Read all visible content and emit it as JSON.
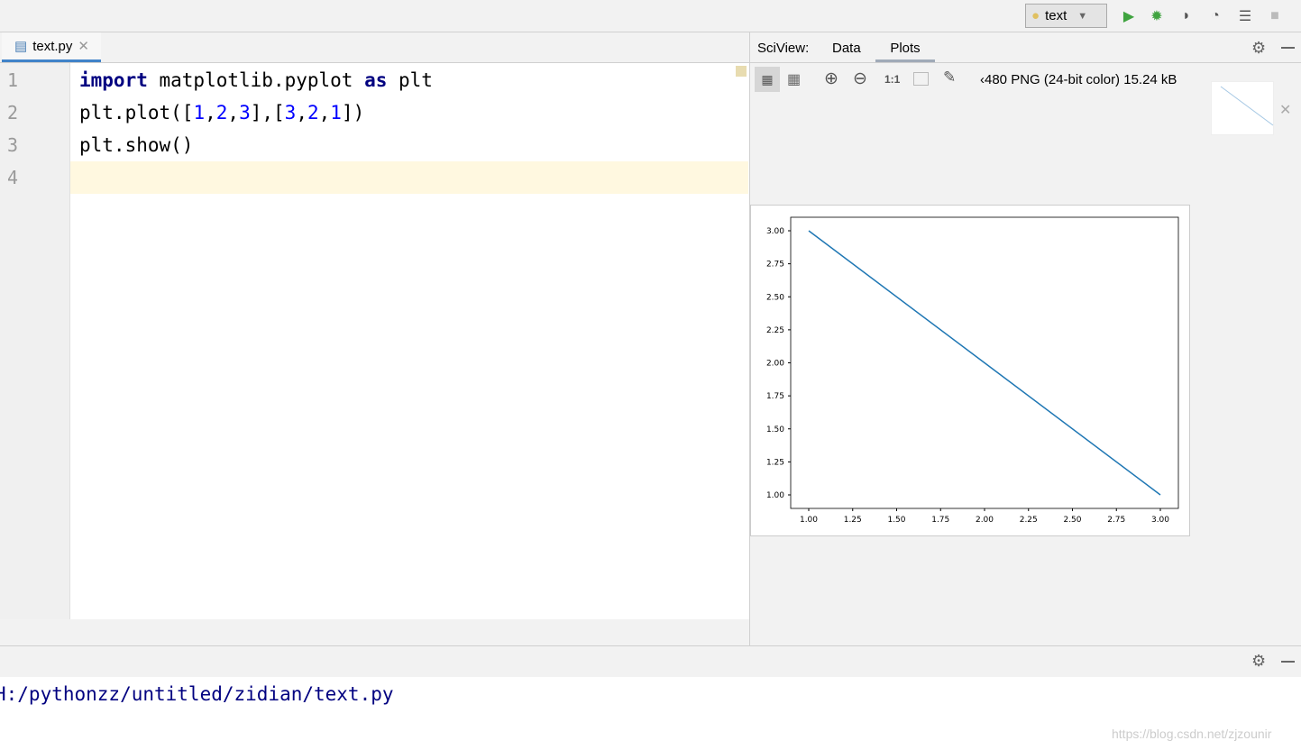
{
  "toolbar": {
    "run_config": "text",
    "icons": [
      "python-icon",
      "run-icon",
      "debug-icon",
      "coverage-icon",
      "profile-icon",
      "run-concurrency-icon",
      "stop-icon"
    ]
  },
  "editor": {
    "tab": "text.py",
    "lines": [
      {
        "n": "1"
      },
      {
        "n": "2"
      },
      {
        "n": "3"
      },
      {
        "n": "4"
      }
    ],
    "code": {
      "l1_kw1": "import",
      "l1_mid": " matplotlib.pyplot ",
      "l1_kw2": "as",
      "l1_end": " plt",
      "l2": [
        "plt.plot([",
        "1",
        ",",
        "2",
        ",",
        "3",
        "],[",
        "3",
        ",",
        "2",
        ",",
        "1",
        "])"
      ],
      "l3": "plt.show()"
    }
  },
  "sciview": {
    "label": "SciView:",
    "tabs": [
      "Data",
      "Plots"
    ],
    "active_tab": "Plots",
    "image_info": "‹480 PNG (24-bit color) 15.24 kB"
  },
  "console": {
    "path": "H:/pythonzz/untitled/zidian/text.py"
  },
  "watermark": "https://blog.csdn.net/zjzounir",
  "chart_data": {
    "type": "line",
    "x": [
      1,
      2,
      3
    ],
    "y": [
      3,
      2,
      1
    ],
    "xlim": [
      1,
      3
    ],
    "ylim": [
      1,
      3
    ],
    "xticks": [
      "1.00",
      "1.25",
      "1.50",
      "1.75",
      "2.00",
      "2.25",
      "2.50",
      "2.75",
      "3.00"
    ],
    "yticks": [
      "1.00",
      "1.25",
      "1.50",
      "1.75",
      "2.00",
      "2.25",
      "2.50",
      "2.75",
      "3.00"
    ],
    "color": "#1f77b4",
    "grid": false
  }
}
